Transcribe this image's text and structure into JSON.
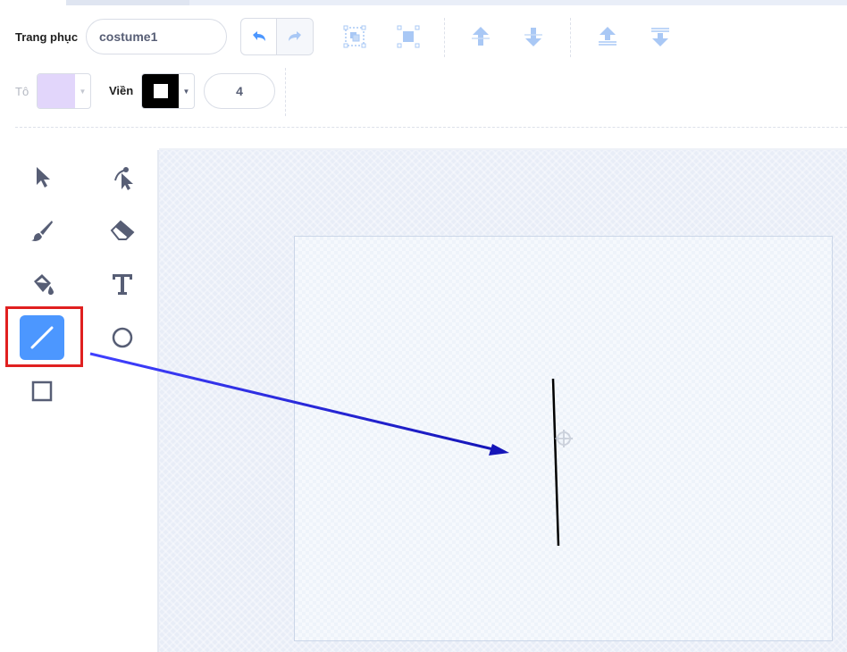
{
  "costume": {
    "label": "Trang phục",
    "name_value": "costume1"
  },
  "fill": {
    "label": "Tô",
    "color": "#e2d6fb"
  },
  "outline": {
    "label": "Viền",
    "color": "#000000",
    "size_value": "4"
  },
  "toolbar": {
    "icons": [
      "undo-icon",
      "redo-icon",
      "group-icon",
      "ungroup-icon",
      "forward-icon",
      "backward-icon",
      "front-icon",
      "back-icon"
    ]
  },
  "tools": [
    "select-tool",
    "reshape-tool",
    "brush-tool",
    "eraser-tool",
    "fill-tool",
    "text-tool",
    "line-tool",
    "circle-tool",
    "rectangle-tool"
  ],
  "selected_tool": "line-tool",
  "colors": {
    "accent": "#4c97ff",
    "annotation_box": "#e02020",
    "annotation_arrow": "#1a1acc"
  }
}
